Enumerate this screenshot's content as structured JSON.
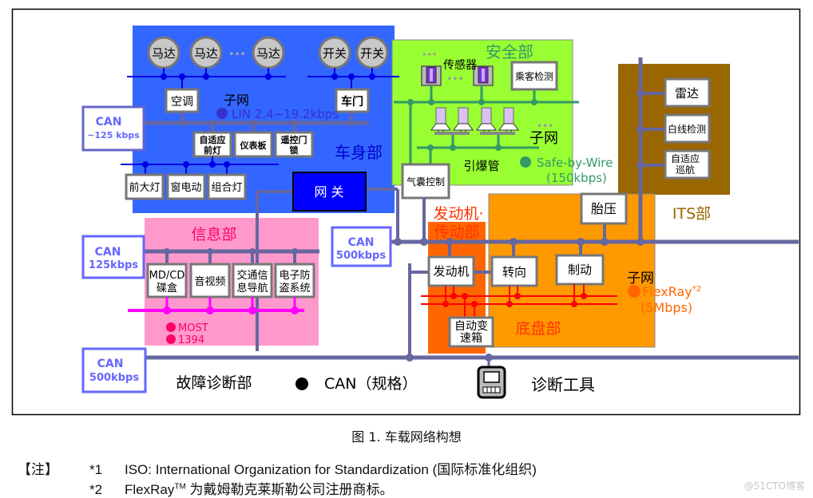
{
  "colors": {
    "body_domain": "#3366ff",
    "safety_domain": "#99ff33",
    "its_domain": "#996600",
    "info_domain": "#ff99cc",
    "engine_domain": "#ff6600",
    "chassis_domain": "#ff9900",
    "can_bus": "#6666a0",
    "lin_bus": "#0000e6",
    "safe_bus": "#339966",
    "most_bus": "#ff00ff",
    "flexray_bus": "#ff0000",
    "gateway": "#0000ff"
  },
  "body_domain": {
    "title": "车身部",
    "motors": [
      "马达",
      "马达",
      "马达"
    ],
    "switches": [
      "开关",
      "开关"
    ],
    "ellipsis": "•••",
    "subnet_label": "子网",
    "lin_label": "LIN 2.4~19.2kbps",
    "ecus_upper": [
      "空调",
      "车门"
    ],
    "ecus_middle": [
      "自适应\n前灯",
      "仪表板",
      "遥控门\n锁"
    ],
    "ecus_lower": [
      "前大灯",
      "窗电动",
      "组合灯"
    ],
    "gateway": "网 关"
  },
  "can_labels": {
    "body": {
      "name": "CAN",
      "speed": "~125 kbps"
    },
    "info": {
      "name": "CAN",
      "speed": "125kbps"
    },
    "powertrain": {
      "name": "CAN",
      "speed": "500kbps"
    },
    "diagnostic": {
      "name": "CAN",
      "speed": "500kbps"
    }
  },
  "safety_domain": {
    "title": "安全部",
    "sensor_label": "传感器",
    "occupant": "乘客检测",
    "subnet_label": "子网",
    "igniter_label": "引爆管",
    "bus_label": "Safe-by-Wire",
    "bus_speed": "(150kbps)",
    "airbag": "气囊控制"
  },
  "its_domain": {
    "title": "ITS部",
    "ecus": [
      "雷达",
      "白线检测",
      "自适应\n巡航"
    ]
  },
  "info_domain": {
    "title": "信息部",
    "ecus": [
      "MD/CD\n碟盒",
      "音视频",
      "交通信\n息导航",
      "电子防\n盗系统"
    ],
    "bus_labels": [
      "MOST",
      "1394"
    ]
  },
  "powertrain_domain": {
    "title_line1": "发动机·",
    "title_line2": "传动部",
    "engine": "发动机",
    "transmission": "自动变\n速箱"
  },
  "chassis_domain": {
    "title": "底盘部",
    "tire": "胎压",
    "steering": "转向",
    "brake": "制动",
    "subnet_label": "子网",
    "bus_label": "FlexRay",
    "bus_sup": "*2",
    "bus_speed": "(5Mbps)"
  },
  "diagnostic": {
    "title": "故障诊断部",
    "legend_can": "CAN（规格）",
    "tool": "诊断工具"
  },
  "caption": "图 1.   车载网络构想",
  "notes": {
    "label": "【注】",
    "items": [
      {
        "num": "*1",
        "text": "ISO: International Organization for Standardization (国际标准化组织)"
      },
      {
        "num": "*2",
        "text_pre": "FlexRay",
        "sup": "TM",
        "text_post": " 为戴姆勒克莱斯勒公司注册商标。"
      }
    ]
  },
  "watermark": "@51CTO博客"
}
